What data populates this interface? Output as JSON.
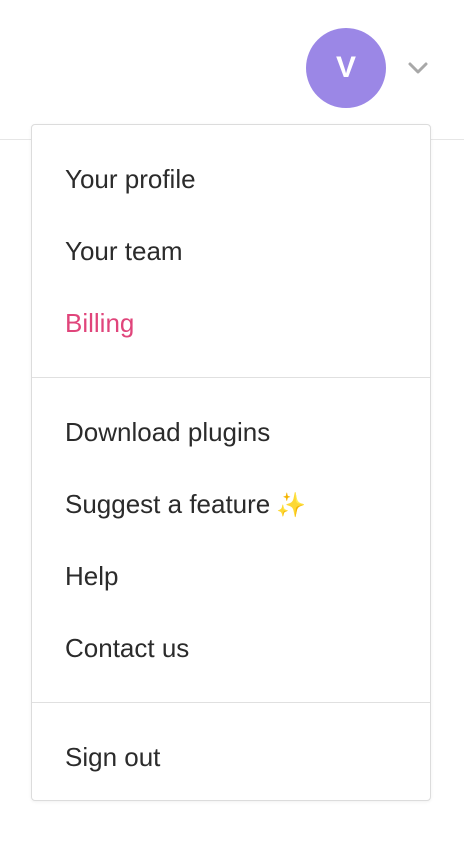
{
  "header": {
    "avatar_letter": "V",
    "avatar_color": "#9b87e6"
  },
  "menu": {
    "groups": [
      {
        "items": [
          {
            "label": "Your profile"
          },
          {
            "label": "Your team"
          },
          {
            "label": "Billing",
            "color": "#e0457b"
          }
        ]
      },
      {
        "items": [
          {
            "label": "Download plugins"
          },
          {
            "label": "Suggest a feature",
            "emoji": "✨"
          },
          {
            "label": "Help"
          },
          {
            "label": "Contact us"
          }
        ]
      },
      {
        "items": [
          {
            "label": "Sign out"
          }
        ]
      }
    ]
  },
  "icons": {
    "chevron": "chevron-down-icon",
    "sparkles": "sparkles-icon"
  }
}
